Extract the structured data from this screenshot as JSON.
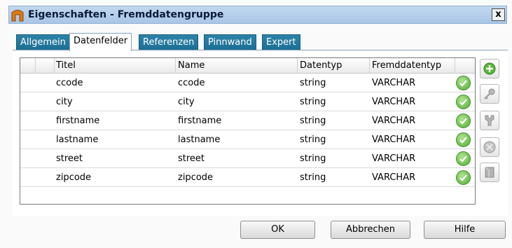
{
  "window": {
    "title": "Eigenschaften - Fremddatengruppe",
    "close_label": "x"
  },
  "tabs": [
    {
      "label": "Allgemein",
      "active": false
    },
    {
      "label": "Datenfelder",
      "active": true
    },
    {
      "label": "Referenzen",
      "active": false
    },
    {
      "label": "Pinnwand",
      "active": false
    },
    {
      "label": "Expert",
      "active": false
    }
  ],
  "grid": {
    "columns": [
      "Titel",
      "Name",
      "Datentyp",
      "Fremddatentyp"
    ],
    "rows": [
      {
        "titel": "ccode",
        "name": "ccode",
        "datentyp": "string",
        "fremddatentyp": "VARCHAR",
        "status": "ok-icon"
      },
      {
        "titel": "city",
        "name": "city",
        "datentyp": "string",
        "fremddatentyp": "VARCHAR",
        "status": "ok-icon"
      },
      {
        "titel": "firstname",
        "name": "firstname",
        "datentyp": "string",
        "fremddatentyp": "VARCHAR",
        "status": "ok-icon"
      },
      {
        "titel": "lastname",
        "name": "lastname",
        "datentyp": "string",
        "fremddatentyp": "VARCHAR",
        "status": "ok-icon"
      },
      {
        "titel": "street",
        "name": "street",
        "datentyp": "string",
        "fremddatentyp": "VARCHAR",
        "status": "ok-icon"
      },
      {
        "titel": "zipcode",
        "name": "zipcode",
        "datentyp": "string",
        "fremddatentyp": "VARCHAR",
        "status": "ok-icon"
      }
    ]
  },
  "side_toolbar": [
    {
      "icon": "add-icon",
      "enabled": true
    },
    {
      "icon": "key-icon",
      "enabled": false
    },
    {
      "icon": "wrench-icon",
      "enabled": false
    },
    {
      "icon": "delete-icon",
      "enabled": false
    },
    {
      "icon": "page-icon",
      "enabled": false
    }
  ],
  "buttons": {
    "ok": "OK",
    "cancel": "Abbrechen",
    "help": "Hilfe"
  },
  "colors": {
    "tab_bg": "#2d82a8",
    "ok_check": "#54ad36",
    "titlebar": "#b7d0ea"
  }
}
